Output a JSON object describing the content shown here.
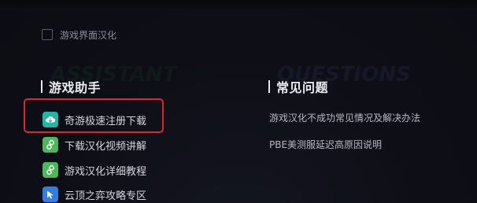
{
  "settings": {
    "checkbox_label": "游戏界面汉化",
    "checked": false
  },
  "left_section": {
    "bg_word": "ASSISTANT",
    "title": "游戏助手",
    "items": [
      {
        "label": "奇游极速注册下载",
        "icon": "cloud-download-icon",
        "icon_color": "#22b6a5",
        "highlighted": true
      },
      {
        "label": "下载汉化视频讲解",
        "icon": "link-icon",
        "icon_color": "#4cb85a"
      },
      {
        "label": "游戏汉化详细教程",
        "icon": "link-icon",
        "icon_color": "#4cb85a"
      },
      {
        "label": "云顶之弈攻略专区",
        "icon": "cursor-icon",
        "icon_color": "#2f7fe0"
      }
    ]
  },
  "right_section": {
    "bg_word": "QUESTIONS",
    "title": "常见问题",
    "items": [
      {
        "label": "游戏汉化不成功常见情况及解决办法"
      },
      {
        "label": "PBE美测服延迟高原因说明"
      }
    ]
  },
  "colors": {
    "background": "#0e0f16",
    "highlight_border": "#e0242b",
    "title_text": "#ecedf1",
    "item_text": "#d4d6de",
    "question_text": "#b6b9c4"
  }
}
